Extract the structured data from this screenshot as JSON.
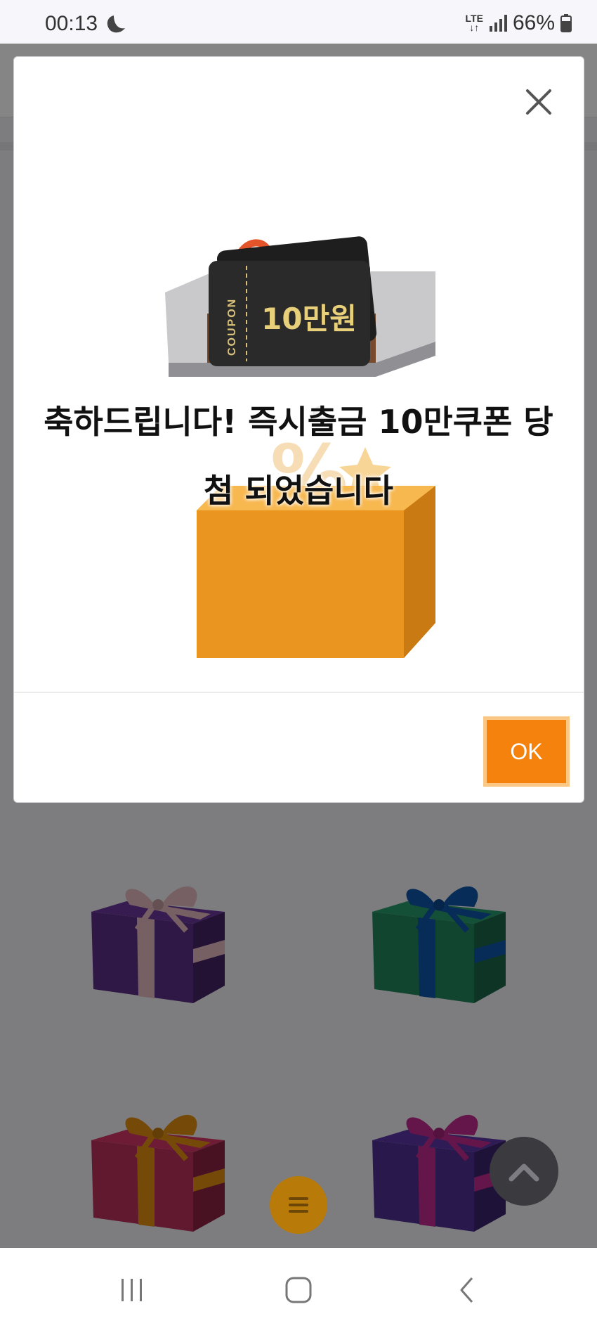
{
  "status_bar": {
    "time": "00:13",
    "network_top": "LTE",
    "network_arrows": "↓↑",
    "battery_percent": "66%"
  },
  "dialog": {
    "coupon_label": "COUPON",
    "coupon_amount": "10만원",
    "message_line1": "축하드립니다! 즉시출금 10만쿠폰 당",
    "message_line2": "첨 되었습니다",
    "ok_label": "OK"
  },
  "background_gifts": [
    {
      "box": "#5b2f86",
      "ribbon": "#e4b8be"
    },
    {
      "box": "#23855d",
      "ribbon": "#0d55a7"
    },
    {
      "box": "#b8305a",
      "ribbon": "#e08f12"
    },
    {
      "box": "#4e2f91",
      "ribbon": "#c02a8e"
    }
  ],
  "colors": {
    "accent": "#f6820e",
    "ok_border": "#fbc785",
    "menu_fab": "#b87a08",
    "scroll_top_fab": "#3a3a3f"
  },
  "icons": {
    "close": "close-icon",
    "menu": "menu-icon",
    "scroll_top": "chevron-up-icon",
    "nav_recent": "recent-apps-icon",
    "nav_home": "home-icon",
    "nav_back": "back-icon"
  }
}
